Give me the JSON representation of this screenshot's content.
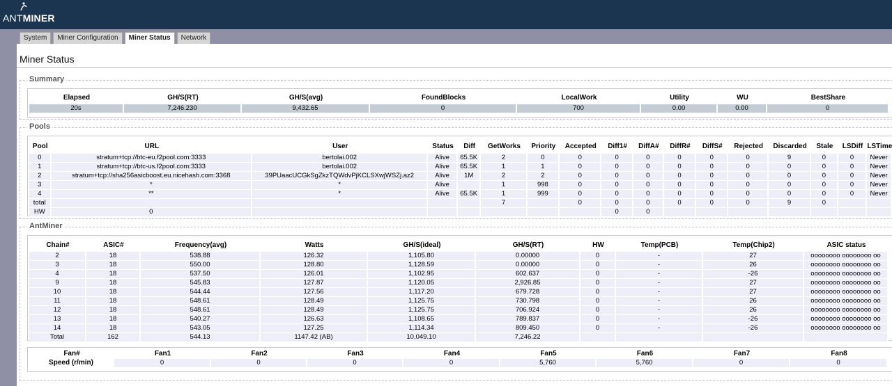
{
  "brand": {
    "logo_light": "ANT",
    "logo_bold": "MINER"
  },
  "tabs": [
    {
      "label": "System"
    },
    {
      "label": "Miner Configuration"
    },
    {
      "label": "Miner Status"
    },
    {
      "label": "Network"
    }
  ],
  "page_title": "Miner Status",
  "summary": {
    "legend": "Summary",
    "headers": [
      "Elapsed",
      "GH/S(RT)",
      "GH/S(avg)",
      "FoundBlocks",
      "LocalWork",
      "Utility",
      "WU",
      "BestShare"
    ],
    "values": [
      "20s",
      "7,246.230",
      "9,432.65",
      "0",
      "700",
      "0.00",
      "0.00",
      "0"
    ]
  },
  "pools": {
    "legend": "Pools",
    "headers": [
      "Pool",
      "URL",
      "User",
      "Status",
      "Diff",
      "GetWorks",
      "Priority",
      "Accepted",
      "Diff1#",
      "DiffA#",
      "DiffR#",
      "DiffS#",
      "Rejected",
      "Discarded",
      "Stale",
      "LSDiff",
      "LSTime"
    ],
    "rows": [
      [
        "0",
        "stratum+tcp://btc-eu.f2pool.com:3333",
        "bertolai.002",
        "Alive",
        "65.5K",
        "2",
        "0",
        "0",
        "0",
        "0",
        "0",
        "0",
        "0",
        "9",
        "0",
        "0",
        "Never"
      ],
      [
        "1",
        "stratum+tcp://btc-us.f2pool.com:3333",
        "bertolai.002",
        "Alive",
        "65.5K",
        "1",
        "1",
        "0",
        "0",
        "0",
        "0",
        "0",
        "0",
        "0",
        "0",
        "0",
        "Never"
      ],
      [
        "2",
        "stratum+tcp://sha256asicboost.eu.nicehash.com:3368",
        "39PUaacUCGkSgZkzTQWdvPjKCLSXwjWSZj.az2",
        "Alive",
        "1M",
        "2",
        "2",
        "0",
        "0",
        "0",
        "0",
        "0",
        "0",
        "0",
        "0",
        "0",
        "Never"
      ],
      [
        "3",
        "*",
        "*",
        "Alive",
        "",
        "1",
        "998",
        "0",
        "0",
        "0",
        "0",
        "0",
        "0",
        "0",
        "0",
        "0",
        "Never"
      ],
      [
        "4",
        "**",
        "*",
        "Alive",
        "65.5K",
        "1",
        "999",
        "0",
        "0",
        "0",
        "0",
        "0",
        "0",
        "0",
        "0",
        "0",
        "Never"
      ],
      [
        "total",
        "",
        "",
        "",
        "",
        "7",
        "",
        "0",
        "0",
        "0",
        "0",
        "0",
        "0",
        "9",
        "0",
        "",
        ""
      ],
      [
        "HW",
        "0",
        "",
        "",
        "",
        "",
        "",
        "",
        "0",
        "0",
        "",
        "",
        "",
        "",
        "",
        "",
        ""
      ]
    ]
  },
  "antminer": {
    "legend": "AntMiner",
    "headers": [
      "Chain#",
      "ASIC#",
      "Frequency(avg)",
      "Watts",
      "GH/S(ideal)",
      "GH/S(RT)",
      "HW",
      "Temp(PCB)",
      "Temp(Chip2)",
      "ASIC status"
    ],
    "rows": [
      [
        "2",
        "18",
        "538.88",
        "126.32",
        "1,105.80",
        "0.00000",
        "0",
        "-",
        "27",
        "oooooooo oooooooo oo"
      ],
      [
        "3",
        "18",
        "550.00",
        "128.80",
        "1,128.59",
        "0.00000",
        "0",
        "-",
        "26",
        "oooooooo oooooooo oo"
      ],
      [
        "4",
        "18",
        "537.50",
        "126.01",
        "1,102.95",
        "602.637",
        "0",
        "-",
        "-26",
        "oooooooo oooooooo oo"
      ],
      [
        "9",
        "18",
        "545.83",
        "127.87",
        "1,120.05",
        "2,926.85",
        "0",
        "-",
        "27",
        "oooooooo oooooooo oo"
      ],
      [
        "10",
        "18",
        "544.44",
        "127.56",
        "1,117.20",
        "679.728",
        "0",
        "-",
        "27",
        "oooooooo oooooooo oo"
      ],
      [
        "11",
        "18",
        "548.61",
        "128.49",
        "1,125.75",
        "730.798",
        "0",
        "-",
        "26",
        "oooooooo oooooooo oo"
      ],
      [
        "12",
        "18",
        "548.61",
        "128.49",
        "1,125.75",
        "706.924",
        "0",
        "-",
        "26",
        "oooooooo oooooooo oo"
      ],
      [
        "13",
        "18",
        "540.27",
        "126.63",
        "1,108.65",
        "789.837",
        "0",
        "-",
        "-26",
        "oooooooo oooooooo oo"
      ],
      [
        "14",
        "18",
        "543.05",
        "127.25",
        "1,114.34",
        "809.450",
        "0",
        "-",
        "-26",
        "oooooooo oooooooo oo"
      ],
      [
        "Total",
        "162",
        "544.13",
        "1147.42 (AB)",
        "10,049.10",
        "7,246.22",
        "",
        "",
        "",
        ""
      ]
    ],
    "fans": {
      "headers": [
        "Fan#",
        "Fan1",
        "Fan2",
        "Fan3",
        "Fan4",
        "Fan5",
        "Fan6",
        "Fan7",
        "Fan8"
      ],
      "row_label": "Speed (r/min)",
      "values": [
        "0",
        "0",
        "0",
        "0",
        "5,760",
        "5,760",
        "0",
        "0"
      ]
    }
  }
}
